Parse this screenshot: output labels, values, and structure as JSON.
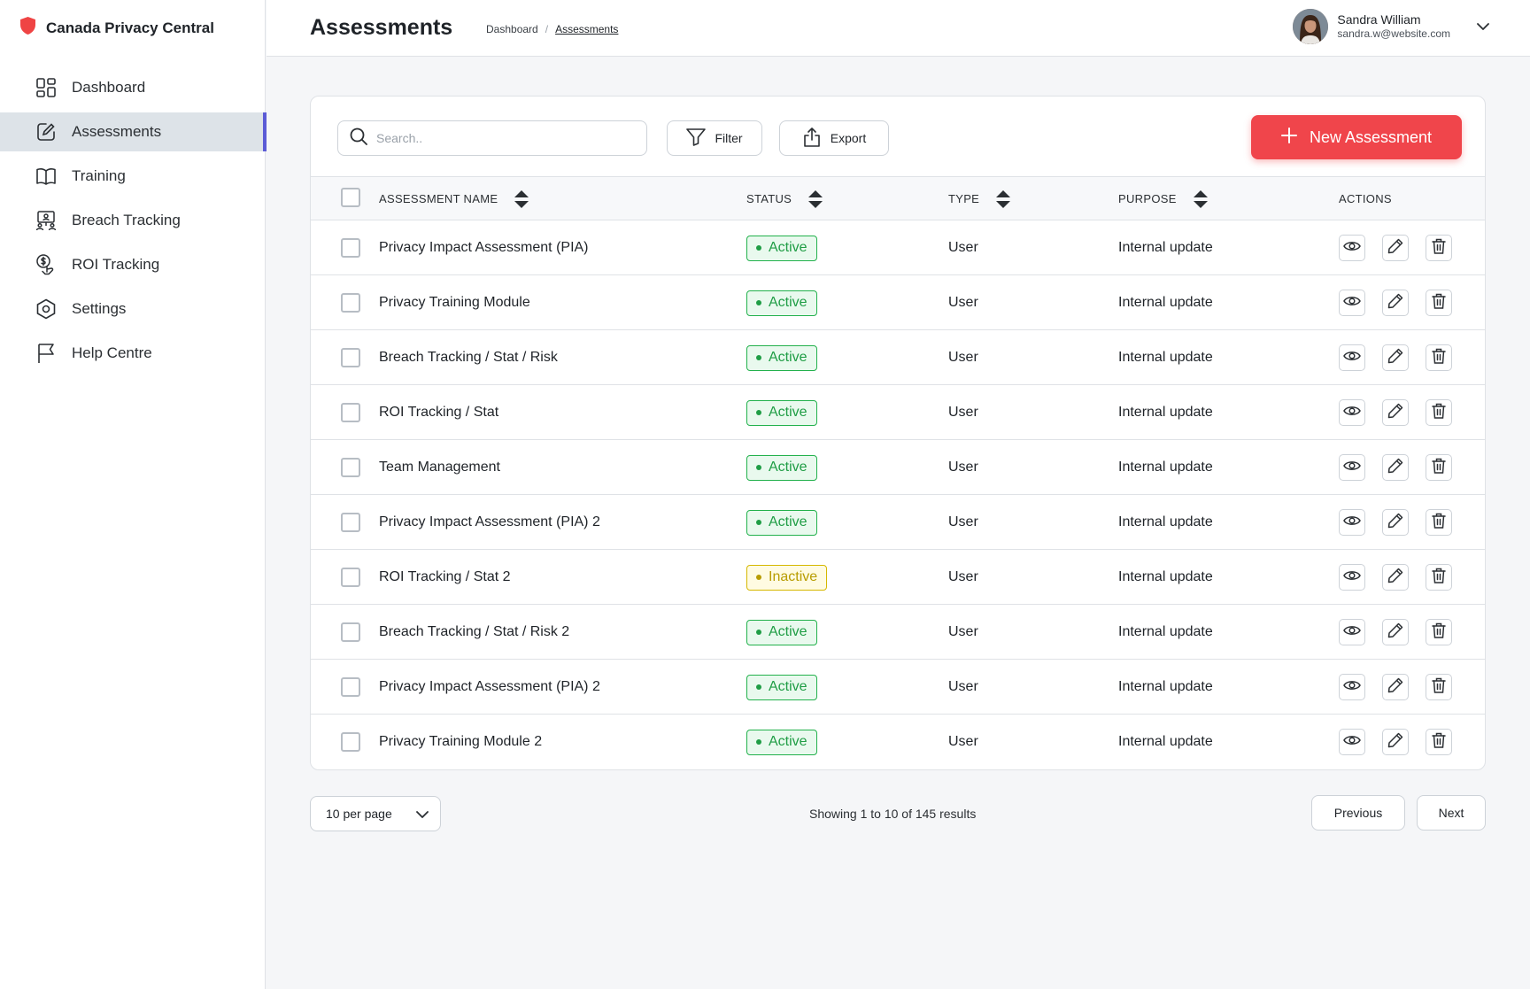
{
  "app": {
    "name": "Canada Privacy Central",
    "brand_color": "#ef4444"
  },
  "sidebar": {
    "items": [
      {
        "label": "Dashboard",
        "icon": "grid-icon"
      },
      {
        "label": "Assessments",
        "icon": "edit-square-icon",
        "active": true
      },
      {
        "label": "Training",
        "icon": "book-icon"
      },
      {
        "label": "Breach Tracking",
        "icon": "monitor-people-icon"
      },
      {
        "label": "ROI Tracking",
        "icon": "dollar-hand-icon"
      },
      {
        "label": "Settings",
        "icon": "hex-gear-icon"
      },
      {
        "label": "Help Centre",
        "icon": "flag-icon"
      }
    ]
  },
  "header": {
    "title": "Assessments",
    "breadcrumb": [
      "Dashboard",
      "Assessments"
    ],
    "user": {
      "name": "Sandra William",
      "email": "sandra.w@website.com"
    }
  },
  "toolbar": {
    "search_placeholder": "Search..",
    "filter_label": "Filter",
    "export_label": "Export",
    "new_label": "New Assessment"
  },
  "table": {
    "columns": [
      "ASSESSMENT NAME",
      "STATUS",
      "TYPE",
      "PURPOSE",
      "ACTIONS"
    ],
    "rows": [
      {
        "name": "Privacy Impact Assessment (PIA)",
        "status": "Active",
        "type": "User",
        "purpose": "Internal update"
      },
      {
        "name": "Privacy Training Module",
        "status": "Active",
        "type": "User",
        "purpose": "Internal update"
      },
      {
        "name": "Breach Tracking / Stat / Risk",
        "status": "Active",
        "type": "User",
        "purpose": "Internal update"
      },
      {
        "name": "ROI Tracking / Stat",
        "status": "Active",
        "type": "User",
        "purpose": "Internal update"
      },
      {
        "name": "Team Management",
        "status": "Active",
        "type": "User",
        "purpose": "Internal update"
      },
      {
        "name": "Privacy Impact Assessment (PIA) 2",
        "status": "Active",
        "type": "User",
        "purpose": "Internal update"
      },
      {
        "name": "ROI Tracking / Stat 2",
        "status": "Inactive",
        "type": "User",
        "purpose": "Internal update"
      },
      {
        "name": "Breach Tracking / Stat / Risk 2",
        "status": "Active",
        "type": "User",
        "purpose": "Internal update"
      },
      {
        "name": "Privacy Impact Assessment (PIA) 2",
        "status": "Active",
        "type": "User",
        "purpose": "Internal update"
      },
      {
        "name": "Privacy Training Module 2",
        "status": "Active",
        "type": "User",
        "purpose": "Internal update"
      }
    ]
  },
  "footer": {
    "per_page": "10 per page",
    "showing": "Showing 1 to 10 of 145 results",
    "previous_label": "Previous",
    "next_label": "Next"
  },
  "colors": {
    "accent": "#5b5bd6",
    "primary_button": "#f0454b",
    "active": "#1f9d45",
    "inactive": "#b89c00"
  }
}
